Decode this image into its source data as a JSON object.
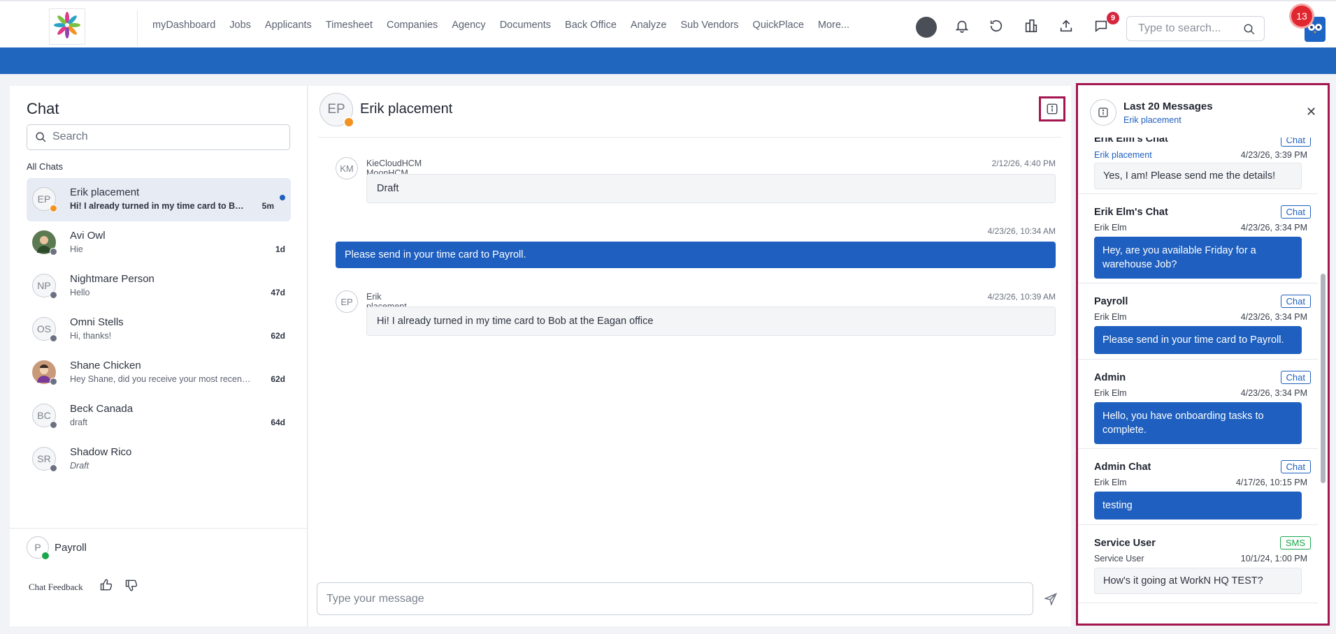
{
  "nav": {
    "items": [
      "myDashboard",
      "Jobs",
      "Applicants",
      "Timesheet",
      "Companies",
      "Agency",
      "Documents",
      "Back Office",
      "Analyze",
      "Sub Vendors",
      "QuickPlace",
      "More..."
    ]
  },
  "topbar": {
    "messages_badge": "9",
    "search_placeholder": "Type to search...",
    "notifications_badge": "13"
  },
  "left": {
    "title": "Chat",
    "search_placeholder": "Search",
    "section_label": "All Chats",
    "chats": [
      {
        "initials": "EP",
        "name": "Erik placement",
        "preview": "Hi! I already turned in my time card to Bob at the Eagan office",
        "time": "5m"
      },
      {
        "initials": "",
        "name": "Avi Owl",
        "preview": "Hie",
        "time": "1d"
      },
      {
        "initials": "NP",
        "name": "Nightmare Person",
        "preview": "Hello",
        "time": "47d"
      },
      {
        "initials": "OS",
        "name": "Omni Stells",
        "preview": "Hi, thanks!",
        "time": "62d"
      },
      {
        "initials": "",
        "name": "Shane Chicken",
        "preview": "Hey Shane, did you receive your most recent paycheck?",
        "time": "62d"
      },
      {
        "initials": "BC",
        "name": "Beck Canada",
        "preview": "draft",
        "time": "64d"
      },
      {
        "initials": "SR",
        "name": "Shadow Rico",
        "preview": "Draft",
        "time": ""
      }
    ],
    "me": {
      "initials": "P",
      "name": "Payroll"
    },
    "feedback_label": "Chat Feedback"
  },
  "center": {
    "initials": "EP",
    "name": "Erik placement",
    "messages": [
      {
        "initials": "KM",
        "sender": "KieCloudHCM MoonHCM",
        "time": "2/12/26, 4:40 PM",
        "text": "Draft"
      },
      {
        "time": "4/23/26, 10:34 AM",
        "text": "Please send in your time card to Payroll."
      },
      {
        "initials": "EP",
        "sender": "Erik placement",
        "time": "4/23/26, 10:39 AM",
        "text": "Hi!  I already turned in my time card to Bob at the Eagan office"
      }
    ],
    "composer_placeholder": "Type your message"
  },
  "right": {
    "title": "Last 20 Messages",
    "subtitle": "Erik placement",
    "cards": [
      {
        "title": "Erik Elm's Chat",
        "tag": "Chat",
        "from": "Erik placement",
        "time": "4/23/26, 3:39 PM",
        "text": "Yes, I am!  Please send me the details!"
      },
      {
        "title": "Erik Elm's Chat",
        "tag": "Chat",
        "from": "Erik Elm",
        "time": "4/23/26, 3:34 PM",
        "text": "Hey, are you available Friday for a warehouse Job?"
      },
      {
        "title": "Payroll",
        "tag": "Chat",
        "from": "Erik Elm",
        "time": "4/23/26, 3:34 PM",
        "text": "Please send in your time card to Payroll."
      },
      {
        "title": "Admin",
        "tag": "Chat",
        "from": "Erik Elm",
        "time": "4/23/26, 3:34 PM",
        "text": "Hello, you have onboarding tasks to complete."
      },
      {
        "title": "Admin Chat",
        "tag": "Chat",
        "from": "Erik Elm",
        "time": "4/17/26, 10:15 PM",
        "text": "testing"
      },
      {
        "title": "Service User",
        "tag": "SMS",
        "from": "Service User",
        "time": "10/1/24, 1:00 PM",
        "text": "How's it going at WorkN HQ TEST?"
      }
    ]
  },
  "colors": {
    "primary": "#1e5fbf",
    "banner": "#2166be",
    "highlight": "#a3164f",
    "away": "#f39220",
    "online": "#1aa64b"
  }
}
